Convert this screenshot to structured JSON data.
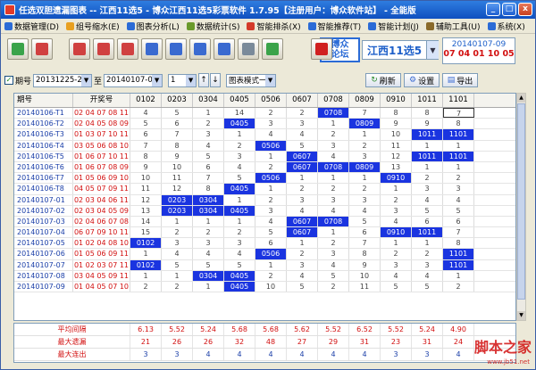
{
  "window": {
    "title": "任选双胆遗漏图表 -- 江西11选5 - 博众江西11选5彩票软件 1.7.95【注册用户：博众软件站】 - 全能版",
    "controls": [
      "_",
      "□",
      "x"
    ]
  },
  "menu": [
    {
      "label": "数据管理(D)",
      "color": "#2b6bd6"
    },
    {
      "label": "组号缩水(E)",
      "color": "#e8a020"
    },
    {
      "label": "图表分析(L)",
      "color": "#2b6bd6"
    },
    {
      "label": "数据统计(S)",
      "color": "#6a9a2a"
    },
    {
      "label": "智能排杀(X)",
      "color": "#d43a2a"
    },
    {
      "label": "智能推荐(T)",
      "color": "#2b6bd6"
    },
    {
      "label": "智能计划(J)",
      "color": "#2b6bd6"
    },
    {
      "label": "辅助工具(U)",
      "color": "#8a6a2a"
    },
    {
      "label": "系统(X)",
      "color": "#2b6bd6"
    }
  ],
  "toolbar": {
    "buttons": [
      {
        "name": "tool-1",
        "color": "#3aa34a"
      },
      {
        "name": "tool-2",
        "color": "#d04040"
      },
      {
        "name": "tool-3",
        "color": "#d04040"
      },
      {
        "name": "tool-4",
        "color": "#d04040"
      },
      {
        "name": "tool-5",
        "color": "#d04040"
      },
      {
        "name": "tool-6",
        "color": "#3a6ad0"
      },
      {
        "name": "tool-7",
        "color": "#3a6ad0"
      },
      {
        "name": "tool-8",
        "color": "#3a6ad0"
      },
      {
        "name": "tool-9",
        "color": "#3a6ad0"
      },
      {
        "name": "tool-10",
        "color": "#7a8a9a"
      },
      {
        "name": "tool-11",
        "color": "#3aa34a"
      },
      {
        "name": "tool-12",
        "color": "#d02020"
      }
    ],
    "logo": [
      "博众",
      "论坛"
    ],
    "lottery": "江西11选5",
    "draw_period": "20140107-09",
    "draw_numbers": "07 04 01 10 05"
  },
  "filter": {
    "period_label": "期号",
    "from": "20131225-24",
    "to_label": "至",
    "to": "20140107-09",
    "count": "1",
    "mode": "图表模式一",
    "refresh": "刷新",
    "settings": "设置",
    "export": "导出"
  },
  "table": {
    "headers": [
      "期号",
      "开奖号",
      "0102",
      "0203",
      "0304",
      "0405",
      "0506",
      "0607",
      "0708",
      "0809",
      "0910",
      "1011",
      "1101"
    ],
    "rows": [
      {
        "period": "20140106-T1",
        "draw": "02 04 07 08 11",
        "cells": [
          [
            "4",
            0
          ],
          [
            "5",
            0
          ],
          [
            "1",
            0
          ],
          [
            "14",
            0
          ],
          [
            "2",
            0
          ],
          [
            "2",
            0
          ],
          [
            "0708",
            1
          ],
          [
            "7",
            0
          ],
          [
            "8",
            0
          ],
          [
            "8",
            0
          ],
          [
            "7",
            2
          ]
        ]
      },
      {
        "period": "20140106-T2",
        "draw": "02 04 05 08 09",
        "cells": [
          [
            "5",
            0
          ],
          [
            "6",
            0
          ],
          [
            "2",
            0
          ],
          [
            "0405",
            1
          ],
          [
            "3",
            0
          ],
          [
            "3",
            0
          ],
          [
            "1",
            0
          ],
          [
            "0809",
            1
          ],
          [
            "9",
            0
          ],
          [
            "9",
            0
          ],
          [
            "8",
            0
          ]
        ]
      },
      {
        "period": "20140106-T3",
        "draw": "01 03 07 10 11",
        "cells": [
          [
            "6",
            0
          ],
          [
            "7",
            0
          ],
          [
            "3",
            0
          ],
          [
            "1",
            0
          ],
          [
            "4",
            0
          ],
          [
            "4",
            0
          ],
          [
            "2",
            0
          ],
          [
            "1",
            0
          ],
          [
            "10",
            0
          ],
          [
            "1011",
            1
          ],
          [
            "1101",
            1
          ]
        ]
      },
      {
        "period": "20140106-T4",
        "draw": "03 05 06 08 10",
        "cells": [
          [
            "7",
            0
          ],
          [
            "8",
            0
          ],
          [
            "4",
            0
          ],
          [
            "2",
            0
          ],
          [
            "0506",
            1
          ],
          [
            "5",
            0
          ],
          [
            "3",
            0
          ],
          [
            "2",
            0
          ],
          [
            "11",
            0
          ],
          [
            "1",
            0
          ],
          [
            "1",
            0
          ]
        ]
      },
      {
        "period": "20140106-T5",
        "draw": "01 06 07 10 11",
        "cells": [
          [
            "8",
            0
          ],
          [
            "9",
            0
          ],
          [
            "5",
            0
          ],
          [
            "3",
            0
          ],
          [
            "1",
            0
          ],
          [
            "0607",
            1
          ],
          [
            "4",
            0
          ],
          [
            "3",
            0
          ],
          [
            "12",
            0
          ],
          [
            "1011",
            1
          ],
          [
            "1101",
            1
          ]
        ]
      },
      {
        "period": "20140106-T6",
        "draw": "01 06 07 08 09",
        "cells": [
          [
            "9",
            0
          ],
          [
            "10",
            0
          ],
          [
            "6",
            0
          ],
          [
            "4",
            0
          ],
          [
            "2",
            0
          ],
          [
            "0607",
            1
          ],
          [
            "0708",
            1
          ],
          [
            "0809",
            1
          ],
          [
            "13",
            0
          ],
          [
            "1",
            0
          ],
          [
            "1",
            0
          ]
        ]
      },
      {
        "period": "20140106-T7",
        "draw": "01 05 06 09 10",
        "cells": [
          [
            "10",
            0
          ],
          [
            "11",
            0
          ],
          [
            "7",
            0
          ],
          [
            "5",
            0
          ],
          [
            "0506",
            1
          ],
          [
            "1",
            0
          ],
          [
            "1",
            0
          ],
          [
            "1",
            0
          ],
          [
            "0910",
            1
          ],
          [
            "2",
            0
          ],
          [
            "2",
            0
          ]
        ]
      },
      {
        "period": "20140106-T8",
        "draw": "04 05 07 09 11",
        "cells": [
          [
            "11",
            0
          ],
          [
            "12",
            0
          ],
          [
            "8",
            0
          ],
          [
            "0405",
            1
          ],
          [
            "1",
            0
          ],
          [
            "2",
            0
          ],
          [
            "2",
            0
          ],
          [
            "2",
            0
          ],
          [
            "1",
            0
          ],
          [
            "3",
            0
          ],
          [
            "3",
            0
          ]
        ]
      },
      {
        "period": "20140107-01",
        "draw": "02 03 04 06 11",
        "cells": [
          [
            "12",
            0
          ],
          [
            "0203",
            1
          ],
          [
            "0304",
            1
          ],
          [
            "1",
            0
          ],
          [
            "2",
            0
          ],
          [
            "3",
            0
          ],
          [
            "3",
            0
          ],
          [
            "3",
            0
          ],
          [
            "2",
            0
          ],
          [
            "4",
            0
          ],
          [
            "4",
            0
          ]
        ]
      },
      {
        "period": "20140107-02",
        "draw": "02 03 04 05 09",
        "cells": [
          [
            "13",
            0
          ],
          [
            "0203",
            1
          ],
          [
            "0304",
            1
          ],
          [
            "0405",
            1
          ],
          [
            "3",
            0
          ],
          [
            "4",
            0
          ],
          [
            "4",
            0
          ],
          [
            "4",
            0
          ],
          [
            "3",
            0
          ],
          [
            "5",
            0
          ],
          [
            "5",
            0
          ]
        ]
      },
      {
        "period": "20140107-03",
        "draw": "02 04 06 07 08",
        "cells": [
          [
            "14",
            0
          ],
          [
            "1",
            0
          ],
          [
            "1",
            0
          ],
          [
            "1",
            0
          ],
          [
            "4",
            0
          ],
          [
            "0607",
            1
          ],
          [
            "0708",
            1
          ],
          [
            "5",
            0
          ],
          [
            "4",
            0
          ],
          [
            "6",
            0
          ],
          [
            "6",
            0
          ]
        ]
      },
      {
        "period": "20140107-04",
        "draw": "06 07 09 10 11",
        "cells": [
          [
            "15",
            0
          ],
          [
            "2",
            0
          ],
          [
            "2",
            0
          ],
          [
            "2",
            0
          ],
          [
            "5",
            0
          ],
          [
            "0607",
            1
          ],
          [
            "1",
            0
          ],
          [
            "6",
            0
          ],
          [
            "0910",
            1
          ],
          [
            "1011",
            1
          ],
          [
            "7",
            0
          ]
        ]
      },
      {
        "period": "20140107-05",
        "draw": "01 02 04 08 10",
        "cells": [
          [
            "0102",
            1
          ],
          [
            "3",
            0
          ],
          [
            "3",
            0
          ],
          [
            "3",
            0
          ],
          [
            "6",
            0
          ],
          [
            "1",
            0
          ],
          [
            "2",
            0
          ],
          [
            "7",
            0
          ],
          [
            "1",
            0
          ],
          [
            "1",
            0
          ],
          [
            "8",
            0
          ]
        ]
      },
      {
        "period": "20140107-06",
        "draw": "01 05 06 09 11",
        "cells": [
          [
            "1",
            0
          ],
          [
            "4",
            0
          ],
          [
            "4",
            0
          ],
          [
            "4",
            0
          ],
          [
            "0506",
            1
          ],
          [
            "2",
            0
          ],
          [
            "3",
            0
          ],
          [
            "8",
            0
          ],
          [
            "2",
            0
          ],
          [
            "2",
            0
          ],
          [
            "1101",
            1
          ]
        ]
      },
      {
        "period": "20140107-07",
        "draw": "01 02 03 07 11",
        "cells": [
          [
            "0102",
            1
          ],
          [
            "5",
            0
          ],
          [
            "5",
            0
          ],
          [
            "5",
            0
          ],
          [
            "1",
            0
          ],
          [
            "3",
            0
          ],
          [
            "4",
            0
          ],
          [
            "9",
            0
          ],
          [
            "3",
            0
          ],
          [
            "3",
            0
          ],
          [
            "1101",
            1
          ]
        ]
      },
      {
        "period": "20140107-08",
        "draw": "03 04 05 09 11",
        "cells": [
          [
            "1",
            0
          ],
          [
            "1",
            0
          ],
          [
            "0304",
            1
          ],
          [
            "0405",
            1
          ],
          [
            "2",
            0
          ],
          [
            "4",
            0
          ],
          [
            "5",
            0
          ],
          [
            "10",
            0
          ],
          [
            "4",
            0
          ],
          [
            "4",
            0
          ],
          [
            "1",
            0
          ]
        ]
      },
      {
        "period": "20140107-09",
        "draw": "01 04 05 07 10",
        "cells": [
          [
            "2",
            0
          ],
          [
            "2",
            0
          ],
          [
            "1",
            0
          ],
          [
            "0405",
            1
          ],
          [
            "10",
            0
          ],
          [
            "5",
            0
          ],
          [
            "2",
            0
          ],
          [
            "11",
            0
          ],
          [
            "5",
            0
          ],
          [
            "5",
            0
          ],
          [
            "2",
            0
          ]
        ]
      }
    ]
  },
  "stats": [
    {
      "label": "平均间隔",
      "values": [
        "6.13",
        "5.52",
        "5.24",
        "5.68",
        "5.68",
        "5.62",
        "5.52",
        "6.52",
        "5.52",
        "5.24",
        "4.90"
      ],
      "color": "#d21010"
    },
    {
      "label": "最大遗漏",
      "values": [
        "21",
        "26",
        "26",
        "32",
        "48",
        "27",
        "29",
        "31",
        "23",
        "31",
        "24"
      ],
      "color": "#d21010"
    },
    {
      "label": "最大连出",
      "values": [
        "3",
        "3",
        "4",
        "4",
        "4",
        "4",
        "4",
        "4",
        "3",
        "3",
        "4"
      ],
      "color": "#1b3fa8"
    }
  ],
  "watermark": {
    "title": "脚本之家",
    "url": "www.jb51.net"
  }
}
